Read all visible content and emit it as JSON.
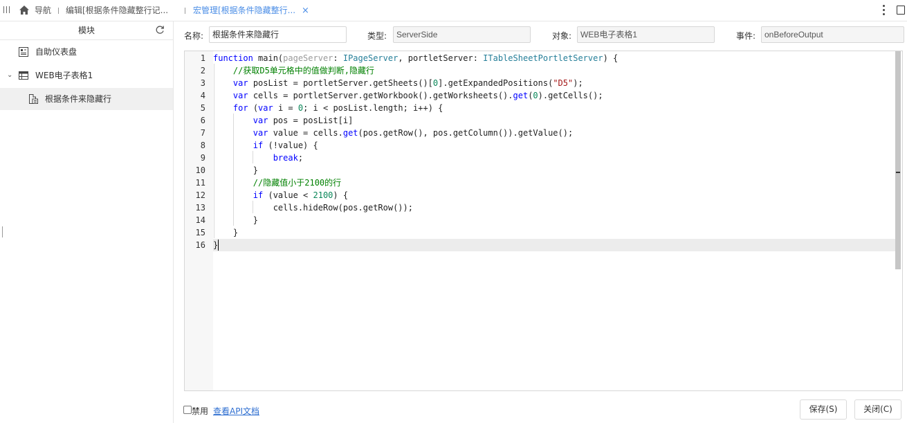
{
  "topbar": {
    "menu_icon": "menu-lines-icon",
    "home_icon": "home-icon",
    "tabs": [
      {
        "label": "导航"
      },
      {
        "label": "编辑[根据条件隐藏整行记..."
      },
      {
        "label": "宏管理[根据条件隐藏整行..."
      }
    ],
    "close_glyph": "×",
    "more_icon": "more-vertical-icon",
    "window_icon": "window-icon",
    "active_color": "#4a8de6"
  },
  "sidebar": {
    "header": "模块",
    "refresh_icon": "refresh-icon",
    "items": [
      {
        "label": "自助仪表盘",
        "icon": "dashboard-icon"
      },
      {
        "label": "WEB电子表格1",
        "icon": "spreadsheet-icon",
        "expanded": true
      },
      {
        "label": "根据条件来隐藏行",
        "icon": "macro-icon",
        "selected": true
      }
    ]
  },
  "form": {
    "name_label": "名称:",
    "name_value": "根据条件来隐藏行",
    "type_label": "类型:",
    "type_value": "ServerSide",
    "object_label": "对象:",
    "object_value": "WEB电子表格1",
    "event_label": "事件:",
    "event_value": "onBeforeOutput"
  },
  "editor": {
    "line_numbers": [
      "1",
      "2",
      "3",
      "4",
      "5",
      "6",
      "7",
      "8",
      "9",
      "10",
      "11",
      "12",
      "13",
      "14",
      "15",
      "16"
    ],
    "active_line": 16,
    "lines": [
      [
        [
          "kw",
          "function"
        ],
        [
          "fn",
          " main("
        ],
        [
          "pm",
          "pageServer"
        ],
        [
          "fn",
          ": "
        ],
        [
          "ty",
          "IPageServer"
        ],
        [
          "fn",
          ", portletServer: "
        ],
        [
          "ty",
          "ITableSheetPortletServer"
        ],
        [
          "fn",
          ") {"
        ]
      ],
      [
        [
          "fn",
          "    "
        ],
        [
          "cm",
          "//获取D5单元格中的值做判断,隐藏行"
        ]
      ],
      [
        [
          "fn",
          "    "
        ],
        [
          "kw",
          "var"
        ],
        [
          "fn",
          " posList = portletServer.getSheets()["
        ],
        [
          "num",
          "0"
        ],
        [
          "fn",
          "].getExpandedPositions("
        ],
        [
          "str",
          "\"D5\""
        ],
        [
          "fn",
          ");"
        ]
      ],
      [
        [
          "fn",
          "    "
        ],
        [
          "kw",
          "var"
        ],
        [
          "fn",
          " cells = portletServer.getWorkbook().getWorksheets()."
        ],
        [
          "kw",
          "get"
        ],
        [
          "fn",
          "("
        ],
        [
          "num",
          "0"
        ],
        [
          "fn",
          ").getCells();"
        ]
      ],
      [
        [
          "fn",
          "    "
        ],
        [
          "kw",
          "for"
        ],
        [
          "fn",
          " ("
        ],
        [
          "kw",
          "var"
        ],
        [
          "fn",
          " i = "
        ],
        [
          "num",
          "0"
        ],
        [
          "fn",
          "; i < posList.length; i++) {"
        ]
      ],
      [
        [
          "fn",
          "        "
        ],
        [
          "kw",
          "var"
        ],
        [
          "fn",
          " pos = posList[i]"
        ]
      ],
      [
        [
          "fn",
          "        "
        ],
        [
          "kw",
          "var"
        ],
        [
          "fn",
          " value = cells."
        ],
        [
          "kw",
          "get"
        ],
        [
          "fn",
          "(pos.getRow(), pos.getColumn()).getValue();"
        ]
      ],
      [
        [
          "fn",
          "        "
        ],
        [
          "kw",
          "if"
        ],
        [
          "fn",
          " (!value) {"
        ]
      ],
      [
        [
          "fn",
          "            "
        ],
        [
          "kw",
          "break"
        ],
        [
          "fn",
          ";"
        ]
      ],
      [
        [
          "fn",
          "        }"
        ]
      ],
      [
        [
          "fn",
          "        "
        ],
        [
          "cm",
          "//隐藏值小于2100的行"
        ]
      ],
      [
        [
          "fn",
          "        "
        ],
        [
          "kw",
          "if"
        ],
        [
          "fn",
          " (value < "
        ],
        [
          "num",
          "2100"
        ],
        [
          "fn",
          ") {"
        ]
      ],
      [
        [
          "fn",
          "            cells.hideRow(pos.getRow());"
        ]
      ],
      [
        [
          "fn",
          "        }"
        ]
      ],
      [
        [
          "fn",
          "    }"
        ]
      ],
      [
        [
          "fn",
          "}"
        ]
      ]
    ],
    "colors": {
      "keyword": "#0000ff",
      "type": "#267f99",
      "comment": "#008000",
      "string": "#a31515",
      "number": "#098658"
    }
  },
  "footer": {
    "disable_label": "禁用",
    "api_link": "查看API文档",
    "save_label": "保存(S)",
    "close_label": "关闭(C)"
  }
}
